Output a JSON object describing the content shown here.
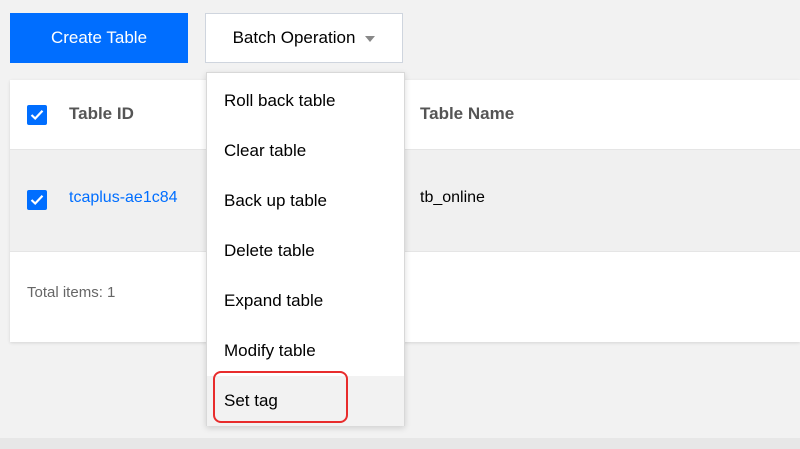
{
  "toolbar": {
    "create_label": "Create Table",
    "batch_label": "Batch Operation"
  },
  "table": {
    "columns": [
      "Table ID",
      "Table Name"
    ],
    "rows": [
      {
        "table_id": "tcaplus-ae1c84",
        "table_name": "tb_online",
        "checked": true
      }
    ],
    "header_checked": true,
    "footer": "Total items: 1"
  },
  "dropdown": {
    "items": [
      "Roll back table",
      "Clear table",
      "Back up table",
      "Delete table",
      "Expand table",
      "Modify table",
      "Set tag"
    ],
    "highlighted_item": "Set tag"
  },
  "colors": {
    "primary": "#006eff",
    "highlight_border": "#e82c2c"
  },
  "icons": [
    "checkbox-checked-icon",
    "caret-down-icon"
  ]
}
